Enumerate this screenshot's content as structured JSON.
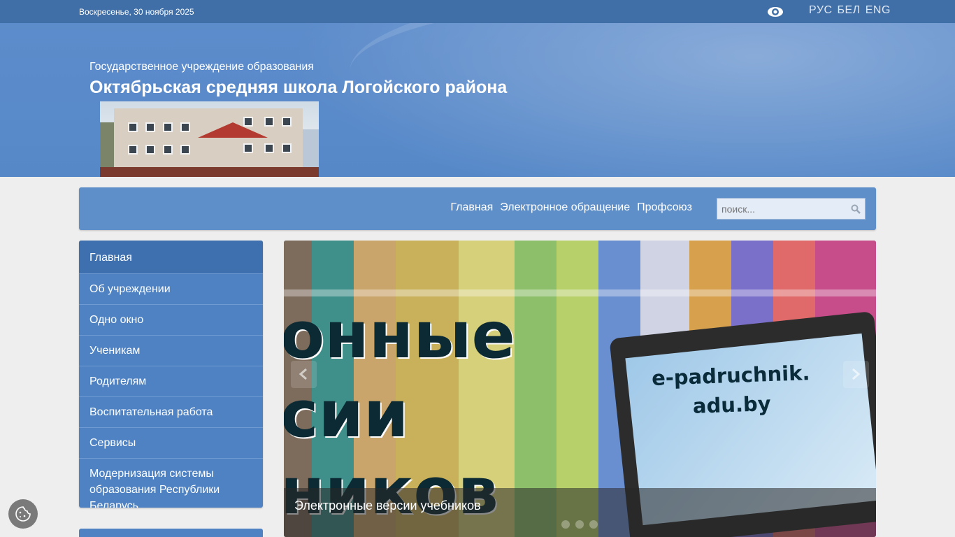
{
  "topbar": {
    "date": "Воскресенье, 30 ноября 2025",
    "visually_impaired_icon": "eye-icon",
    "languages": [
      "РУС",
      "БЕЛ",
      "ENG"
    ]
  },
  "header": {
    "subtitle": "Государственное учреждение образования",
    "title": "Октябрьская средняя школа Логойского района"
  },
  "navbar": {
    "links": [
      "Главная",
      "Электронное обращение",
      "Профсоюз"
    ],
    "search_placeholder": "поиск...",
    "search_icon": "search-icon"
  },
  "sidebar": {
    "items": [
      {
        "label": "Главная",
        "active": true
      },
      {
        "label": "Об учреждении"
      },
      {
        "label": "Одно окно"
      },
      {
        "label": "Ученикам"
      },
      {
        "label": "Родителям"
      },
      {
        "label": "Воспитательная работа"
      },
      {
        "label": "Сервисы"
      },
      {
        "label_line1": "Модернизация системы",
        "label_line2": "образования Республики Беларусь"
      }
    ]
  },
  "slider": {
    "image_text_lines": [
      "онные",
      "сии",
      "ников"
    ],
    "tablet_text_lines": [
      "e-padruchnik.",
      "adu.by"
    ],
    "caption": "Электронные версии учебников",
    "dots": 3,
    "prev_icon": "chevron-left-icon",
    "next_icon": "chevron-right-icon"
  },
  "cookie_icon": "cookie-icon",
  "colors": {
    "topbar": "#3f6fa6",
    "header": "#5688c8",
    "navbar": "#5f8fc9",
    "sidebar": "#4f82c3",
    "sidebar_active": "#3e6fae"
  }
}
